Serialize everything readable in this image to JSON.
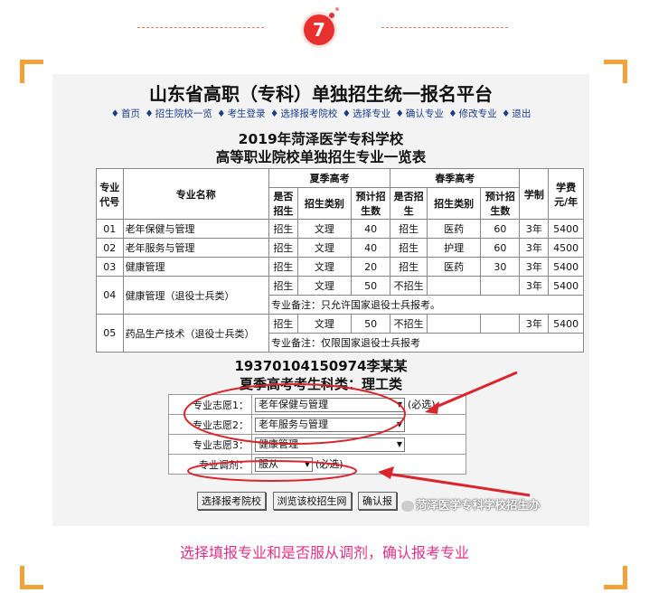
{
  "step": {
    "number": "7",
    "color": "#e8312e"
  },
  "platform": {
    "title": "山东省高职（专科）单独招生统一报名平台",
    "nav": [
      "首页",
      "招生院校一览",
      "考生登录",
      "选择报考院校",
      "选择专业",
      "确认专业",
      "修改专业",
      "退出"
    ]
  },
  "school": {
    "line1": "2019年菏泽医学专科学校",
    "line2": "高等职业院校单独招生专业一览表"
  },
  "table": {
    "header": {
      "code": "专业代号",
      "name": "专业名称",
      "summer": "夏季高考",
      "spring": "春季高考",
      "years": "学制",
      "fee": "学费元/年",
      "enroll": "是否招生",
      "type": "招生类别",
      "plan": "预计招生数"
    },
    "rows": [
      {
        "code": "01",
        "name": "老年保健与管理",
        "s_enroll": "招生",
        "s_type": "文理",
        "s_plan": "40",
        "p_enroll": "招生",
        "p_type": "医药",
        "p_plan": "60",
        "years": "3年",
        "fee": "5400"
      },
      {
        "code": "02",
        "name": "老年服务与管理",
        "s_enroll": "招生",
        "s_type": "文理",
        "s_plan": "40",
        "p_enroll": "招生",
        "p_type": "护理",
        "p_plan": "60",
        "years": "3年",
        "fee": "4500"
      },
      {
        "code": "03",
        "name": "健康管理",
        "s_enroll": "招生",
        "s_type": "文理",
        "s_plan": "20",
        "p_enroll": "招生",
        "p_type": "医药",
        "p_plan": "30",
        "years": "3年",
        "fee": "5400"
      },
      {
        "code": "04",
        "name": "健康管理（退役士兵类）",
        "s_enroll": "招生",
        "s_type": "文理",
        "s_plan": "50",
        "p_enroll": "不招生",
        "p_type": "",
        "p_plan": "",
        "years": "3年",
        "fee": "5400",
        "note": "专业备注：只允许国家退役士兵报考。"
      },
      {
        "code": "05",
        "name": "药品生产技术（退役士兵类）",
        "s_enroll": "招生",
        "s_type": "文理",
        "s_plan": "50",
        "p_enroll": "不招生",
        "p_type": "",
        "p_plan": "",
        "years": "3年",
        "fee": "5400",
        "note": "专业备注：仅限国家退役士兵报考"
      }
    ]
  },
  "student": {
    "id_name": "19370104150974李某某",
    "category": "夏季高考考生科类：理工类"
  },
  "choices": [
    {
      "label": "专业志愿1：",
      "value": "老年保健与管理",
      "required": "(必选)"
    },
    {
      "label": "专业志愿2：",
      "value": "老年服务与管理",
      "required": ""
    },
    {
      "label": "专业志愿3：",
      "value": "健康管理",
      "required": ""
    },
    {
      "label": "专业调剂：",
      "value": "服从",
      "required": "(必选)"
    }
  ],
  "buttons": [
    "选择报考院校",
    "浏览该校招生网",
    "确认报"
  ],
  "watermark": "菏泽医学专科学校招生办",
  "caption": "选择填报专业和是否服从调剂，确认报考专业",
  "colors": {
    "annotation": "#d9252b",
    "caption": "#e0318a",
    "corner": "#f2a23a"
  }
}
